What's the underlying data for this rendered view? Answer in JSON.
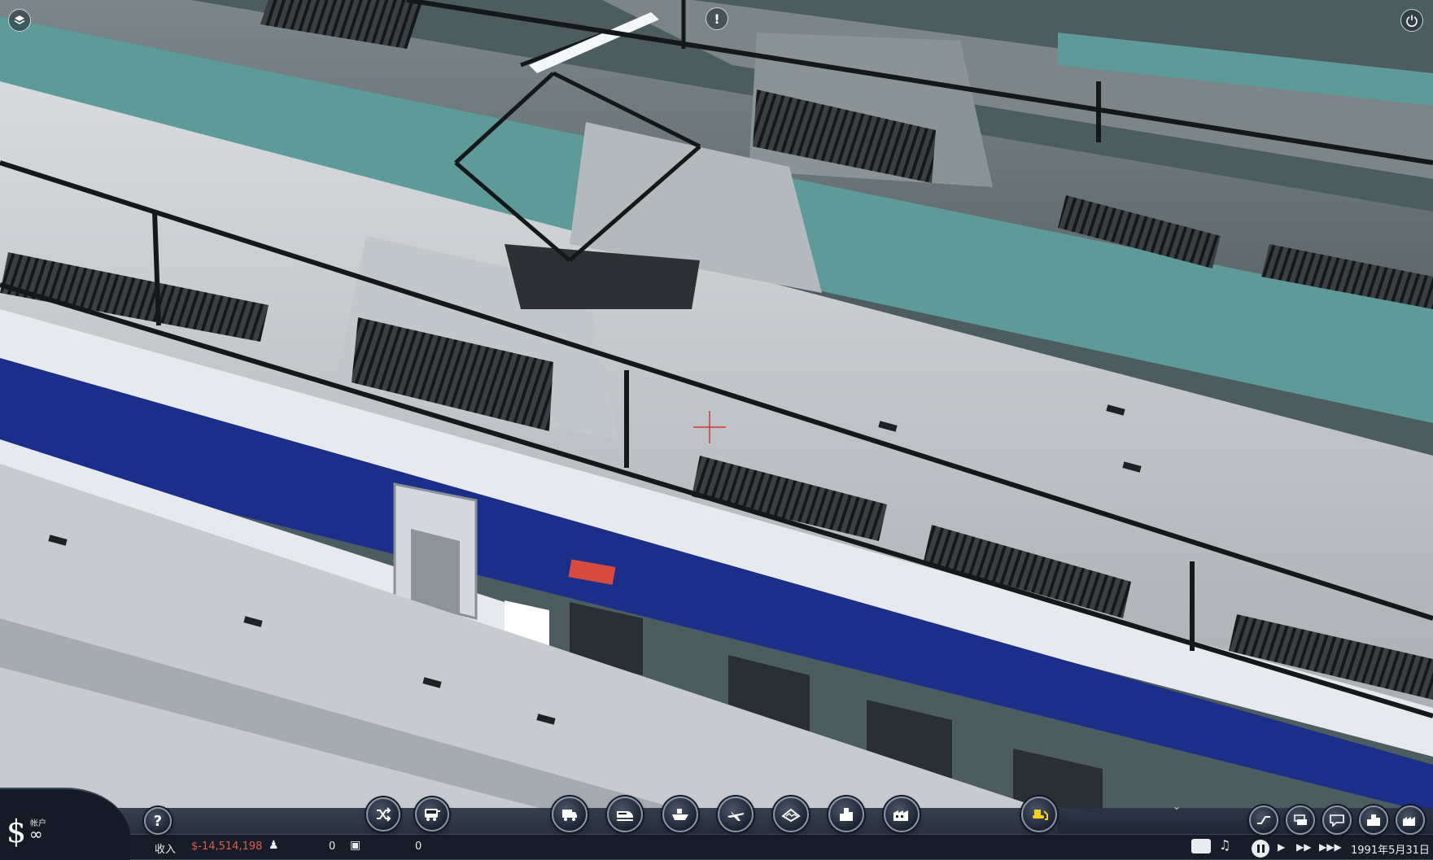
{
  "hud": {
    "account_label": "帐户",
    "account_value": "∞",
    "currency_symbol": "$",
    "income_label": "收入",
    "income_value": "$-14,514,198",
    "passengers_value": "0",
    "cargo_value": "0",
    "date": "1991年5月31日"
  },
  "top_buttons": [
    {
      "name": "layers-icon"
    },
    {
      "name": "alert-icon",
      "glyph": "!"
    },
    {
      "name": "power-icon"
    }
  ],
  "toolbar_buttons": [
    {
      "name": "help-button",
      "icon": "question-icon",
      "glyph": "?"
    },
    {
      "name": "shuffle-button",
      "icon": "shuffle-icon"
    },
    {
      "name": "bus-lines-button",
      "icon": "bus-icon"
    },
    {
      "name": "road-vehicles-button",
      "icon": "truck-icon"
    },
    {
      "name": "trains-button",
      "icon": "train-icon"
    },
    {
      "name": "ships-button",
      "icon": "ship-icon"
    },
    {
      "name": "aircraft-button",
      "icon": "airplane-icon"
    },
    {
      "name": "terrain-button",
      "icon": "terrain-icon"
    },
    {
      "name": "town-button",
      "icon": "town-icon"
    },
    {
      "name": "industry-button",
      "icon": "factory-icon"
    },
    {
      "name": "bulldozer-button",
      "icon": "bulldozer-icon"
    },
    {
      "name": "finance-button",
      "icon": "graph-icon"
    },
    {
      "name": "vehicle-manager-button",
      "icon": "vehicles-icon"
    },
    {
      "name": "messages-button",
      "icon": "message-icon"
    },
    {
      "name": "town-list-button",
      "icon": "building-icon"
    },
    {
      "name": "industry-list-button",
      "icon": "factory-list-icon"
    }
  ],
  "colors": {
    "negative_money": "#e05a4e",
    "train_blue": "#1a2e8a",
    "train_white": "#e8ebef",
    "roof_grey": "#c8ccd0",
    "bulldozer_yellow": "#f2d21e"
  }
}
